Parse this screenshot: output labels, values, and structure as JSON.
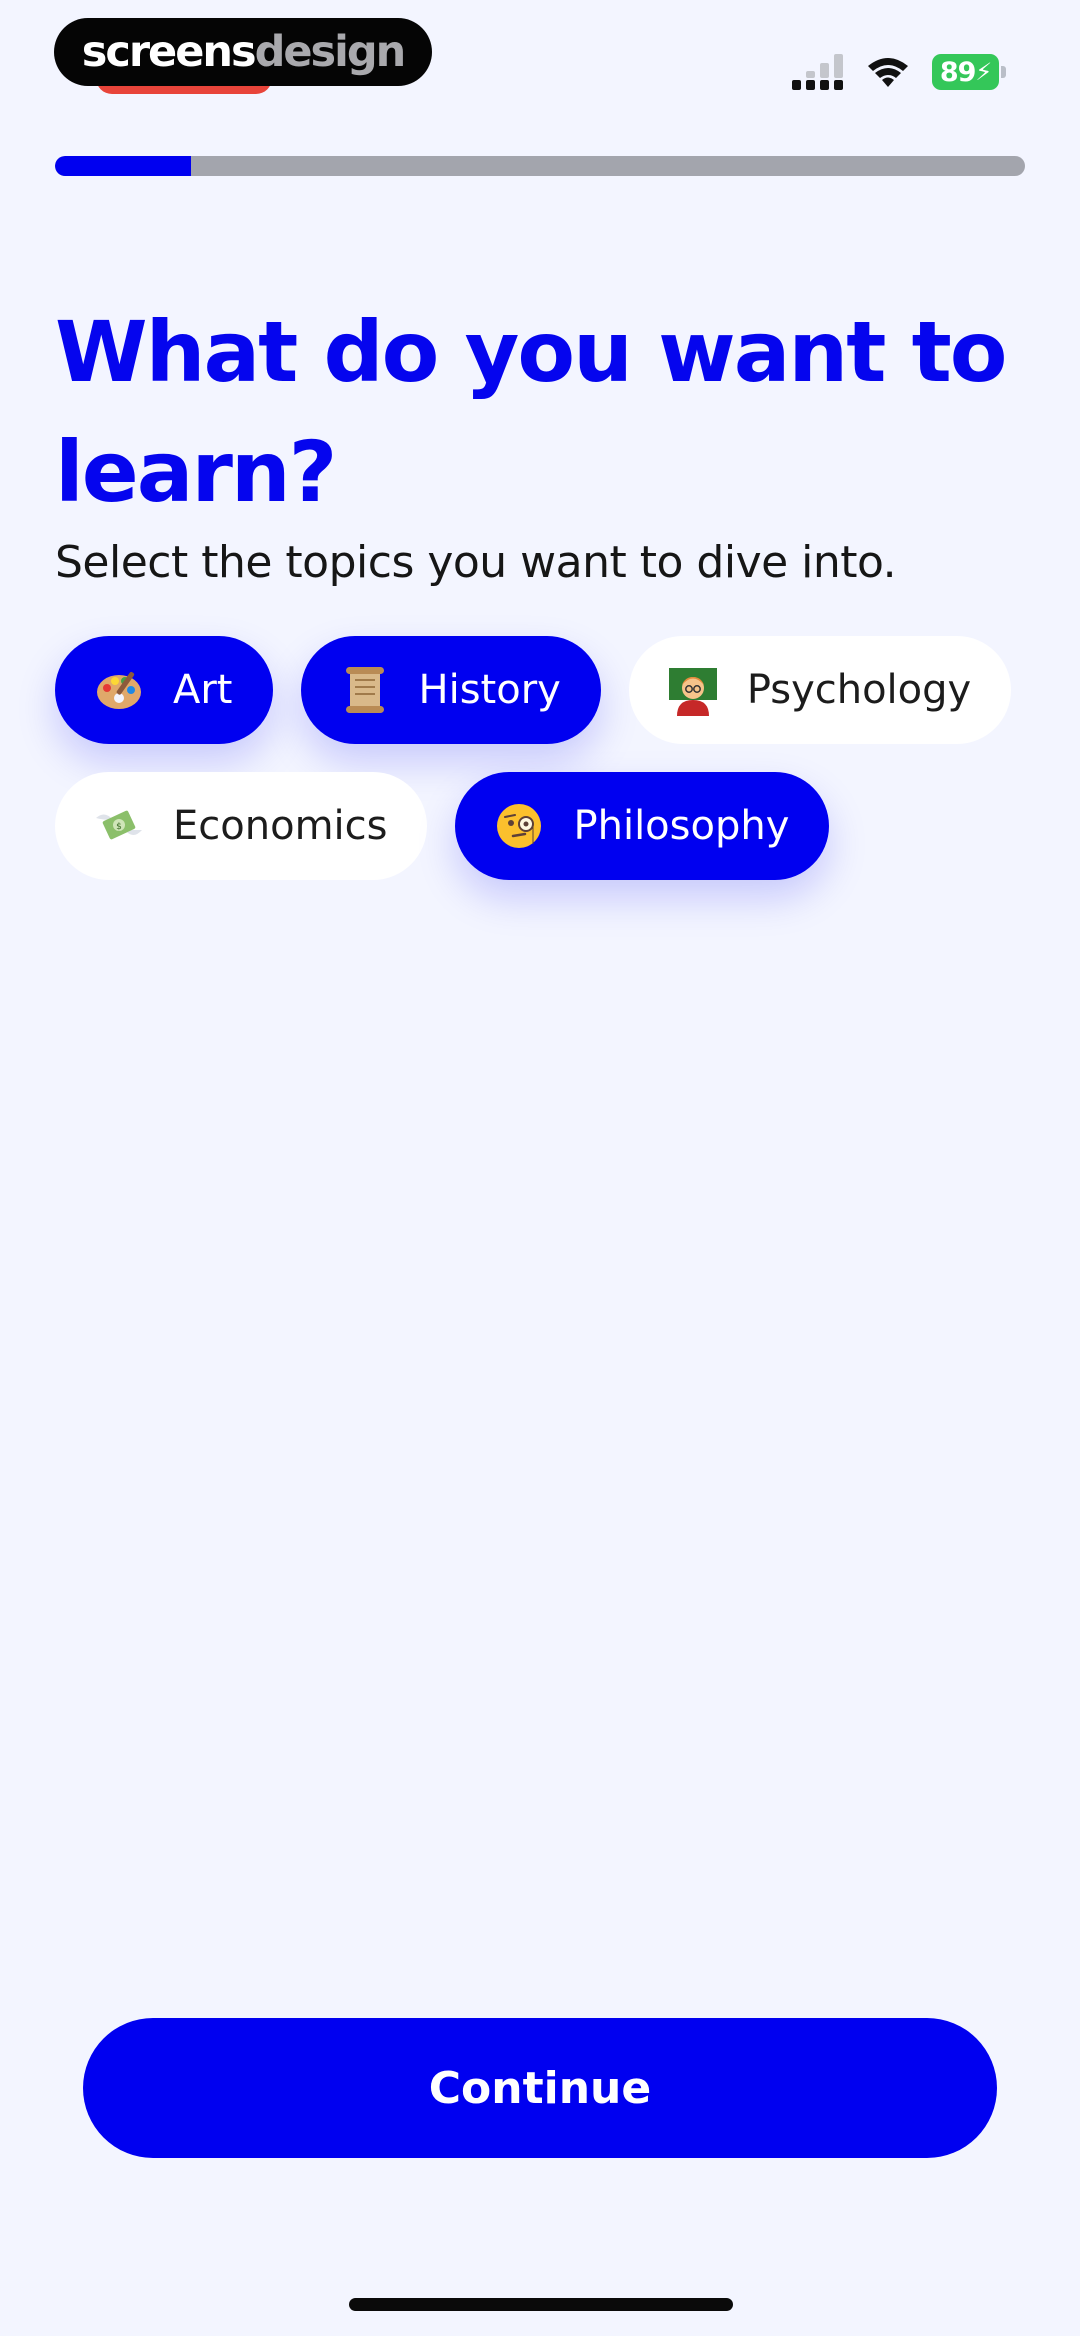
{
  "status_bar": {
    "watermark_part1": "screens",
    "watermark_part2": "design",
    "battery_level": "89",
    "battery_color": "#34c759"
  },
  "progress": {
    "value": 0.14,
    "fill_color": "#0000f0",
    "track_color": "#a3a5ad"
  },
  "header": {
    "title": "What do you want to learn?",
    "subtitle": "Select the topics you want to dive into."
  },
  "topics": [
    {
      "label": "Art",
      "icon": "palette-icon",
      "selected": true
    },
    {
      "label": "History",
      "icon": "scroll-icon",
      "selected": true
    },
    {
      "label": "Psychology",
      "icon": "teacher-icon",
      "selected": false
    },
    {
      "label": "Economics",
      "icon": "money-with-wings-icon",
      "selected": false
    },
    {
      "label": "Philosophy",
      "icon": "monocle-face-icon",
      "selected": true
    }
  ],
  "continue_button": {
    "label": "Continue"
  },
  "colors": {
    "accent": "#0000f0",
    "background": "#f3f5ff",
    "chip_unselected": "#ffffff"
  }
}
